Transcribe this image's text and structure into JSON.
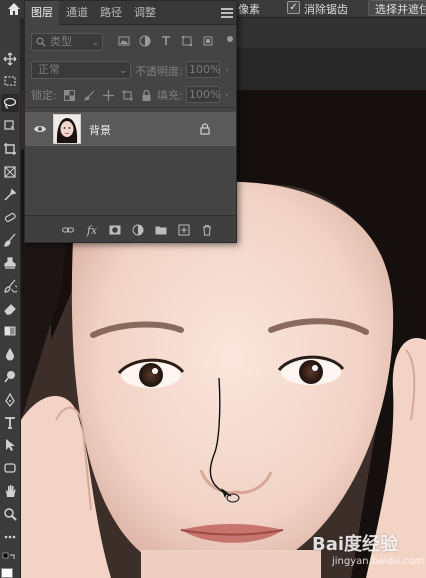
{
  "options_bar": {
    "partial_text": "像素",
    "antialias_label": "消除锯齿",
    "antialias_checked": "✓",
    "select_mask_button": "选择并遮住"
  },
  "layers_panel": {
    "tabs": [
      {
        "label": "图层"
      },
      {
        "label": "通道"
      },
      {
        "label": "路径"
      },
      {
        "label": "调整"
      }
    ],
    "filter": {
      "kind_placeholder": "类型",
      "icons": [
        "image-filter-icon",
        "adjustment-filter-icon",
        "type-filter-icon",
        "shape-filter-icon",
        "smart-object-filter-icon"
      ]
    },
    "blend_mode": "正常",
    "opacity_label": "不透明度:",
    "opacity_value": "100%",
    "lock_label": "锁定:",
    "fill_label": "填充:",
    "fill_value": "100%",
    "layers": [
      {
        "name": "背景",
        "visible": true,
        "locked": true
      }
    ],
    "footer_icons": [
      "link-icon",
      "fx-icon",
      "mask-icon",
      "adjustment-layer-icon",
      "group-folder-icon",
      "new-layer-icon",
      "trash-icon"
    ],
    "fx_label": "fx"
  },
  "toolbar": {
    "tools": [
      "move-tool-icon",
      "marquee-tool-icon",
      "lasso-tool-icon",
      "object-select-tool-icon",
      "crop-tool-icon",
      "frame-tool-icon",
      "eyedropper-tool-icon",
      "healing-brush-icon",
      "brush-tool-icon",
      "stamp-tool-icon",
      "history-brush-icon",
      "eraser-tool-icon",
      "gradient-tool-icon",
      "blur-tool-icon",
      "dodge-tool-icon",
      "pen-tool-icon",
      "type-tool-icon",
      "path-select-icon",
      "rectangle-tool-icon",
      "hand-tool-icon",
      "zoom-tool-icon",
      "more-tools-icon"
    ],
    "active_tool": "lasso-tool-icon"
  },
  "watermark": {
    "brand": "Bai度经验",
    "url": "jingyan.baidu.com"
  },
  "colors": {
    "panel_bg": "#444444",
    "toolbar_bg": "#3b3b3b",
    "selected_layer": "#5a5a5a"
  }
}
